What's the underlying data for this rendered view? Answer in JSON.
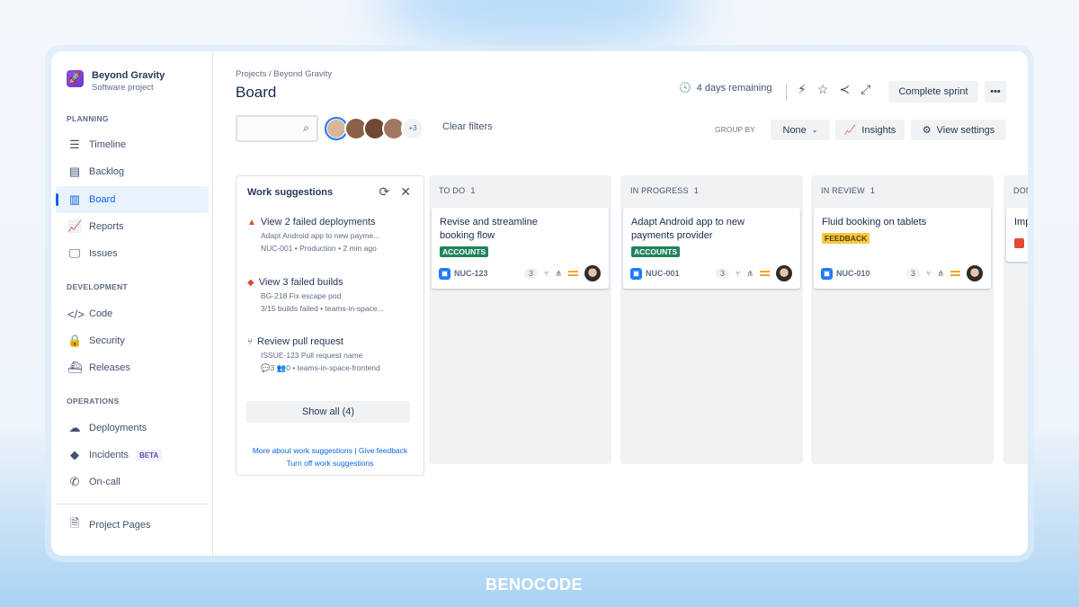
{
  "project": {
    "name": "Beyond Gravity",
    "type": "Software project"
  },
  "sidebar": {
    "sections": [
      {
        "title": "PLANNING"
      },
      {
        "title": "DEVELOPMENT"
      },
      {
        "title": "OPERATIONS"
      }
    ],
    "items": [
      {
        "label": "Timeline",
        "icon": "timeline-icon"
      },
      {
        "label": "Backlog",
        "icon": "backlog-icon"
      },
      {
        "label": "Board",
        "icon": "board-icon",
        "active": true
      },
      {
        "label": "Reports",
        "icon": "reports-icon"
      },
      {
        "label": "Issues",
        "icon": "issues-icon"
      },
      {
        "label": "Code",
        "icon": "code-icon"
      },
      {
        "label": "Security",
        "icon": "lock-icon"
      },
      {
        "label": "Releases",
        "icon": "ship-icon"
      },
      {
        "label": "Deployments",
        "icon": "cloud-upload-icon"
      },
      {
        "label": "Incidents",
        "icon": "incident-icon",
        "badge": "BETA"
      },
      {
        "label": "On-call",
        "icon": "phone-icon"
      },
      {
        "label": "Project Pages",
        "icon": "page-icon"
      }
    ]
  },
  "header": {
    "breadcrumb": "Projects / Beyond Gravity",
    "title": "Board",
    "remaining": "4 days remaining",
    "complete_sprint": "Complete sprint",
    "more": "•••"
  },
  "filters": {
    "search_placeholder": "",
    "more_avatars": "+3",
    "clear": "Clear filters",
    "group_by_label": "GROUP BY",
    "group_by_value": "None",
    "insights": "Insights",
    "view_settings": "View settings"
  },
  "suggestions": {
    "title": "Work suggestions",
    "items": [
      {
        "title": "View 2 failed deployments",
        "line1": "Adapt Android app to new payme...",
        "line2": "NUC-001 • Production • 2 min ago"
      },
      {
        "title": "View 3 failed builds",
        "line1": "BG-218 Fix escape pod",
        "line2": "3/15 builds failed • teams-in-space..."
      },
      {
        "title": "Review pull request",
        "line1": "ISSUE-123 Pull request name",
        "line2": "💬3 👥0 • teams-in-space-frontend"
      }
    ],
    "show_all": "Show all (4)",
    "link_more": "More about work suggestions",
    "link_feedback": "Give feedback",
    "link_off": "Turn off work suggestions"
  },
  "columns": [
    {
      "title": "TO DO",
      "count": "1",
      "card": {
        "title": "Revise and streamline booking flow",
        "label": "ACCOUNTS",
        "key": "NUC-123",
        "comments": "3"
      }
    },
    {
      "title": "IN PROGRESS",
      "count": "1",
      "card": {
        "title": "Adapt Android app to new payments provider",
        "label": "ACCOUNTS",
        "key": "NUC-001",
        "comments": "3"
      }
    },
    {
      "title": "IN REVIEW",
      "count": "1",
      "card": {
        "title": "Fluid booking on tablets",
        "label": "FEEDBACK",
        "key": "NUC-010",
        "comments": "3"
      }
    },
    {
      "title": "DONE",
      "count": "",
      "card": {
        "title": "Imp",
        "label": "",
        "key": "",
        "comments": ""
      }
    }
  ],
  "colors": {
    "accent": "#0c66e4",
    "accounts": "#1f845a",
    "feedback": "#f8c83f",
    "error": "#e34935"
  },
  "brand": "BENOCODE"
}
